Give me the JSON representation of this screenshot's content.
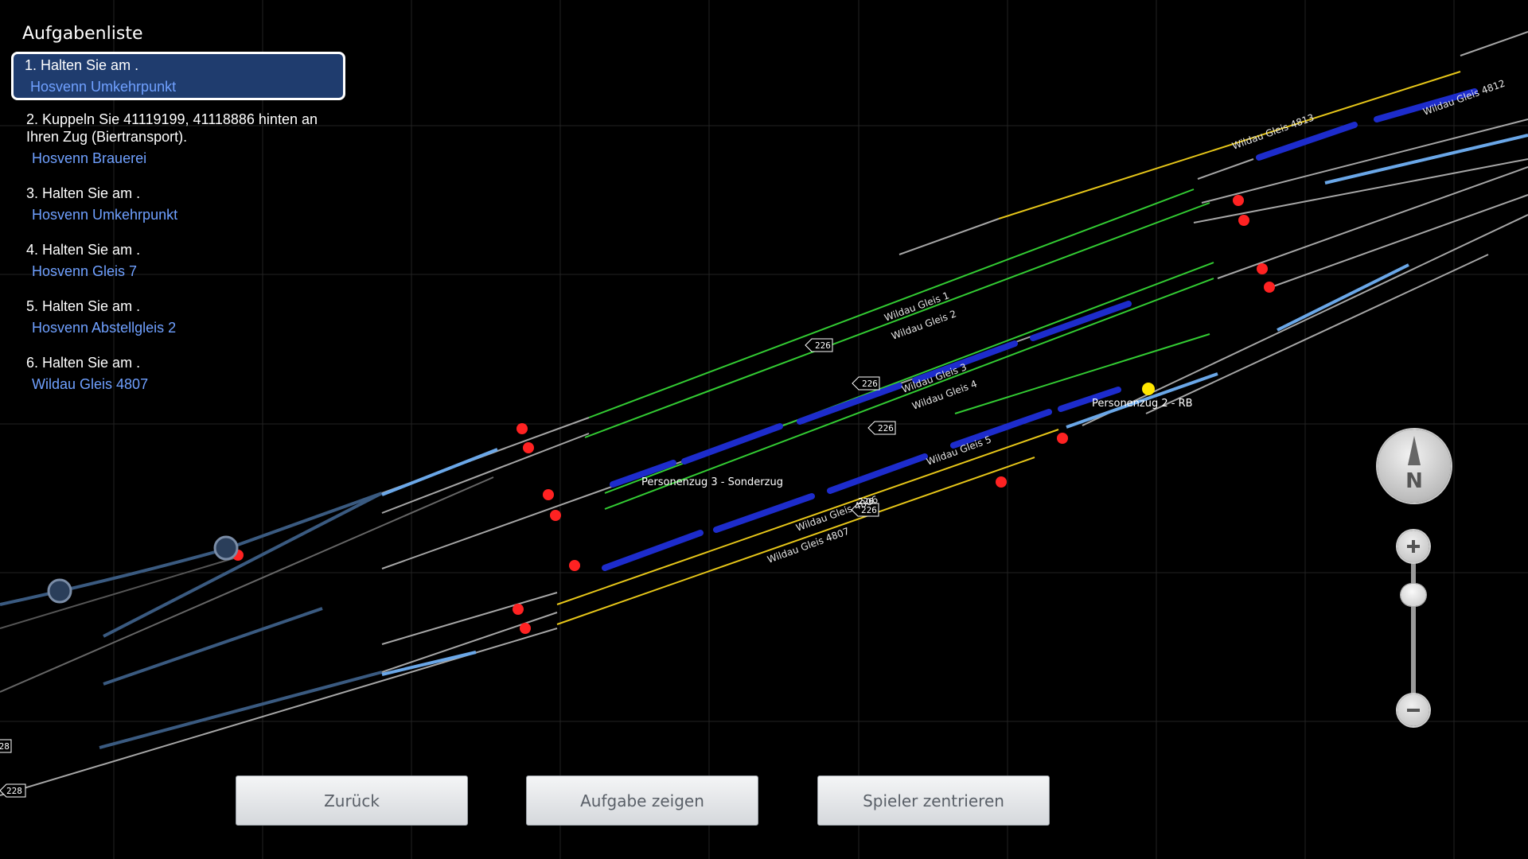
{
  "task_panel": {
    "title": "Aufgabenliste",
    "tasks": [
      {
        "text": "1. Halten Sie am .",
        "location": "Hosvenn Umkehrpunkt"
      },
      {
        "text": "2. Kuppeln Sie 41119199, 41118886 hinten an Ihren Zug (Biertransport).",
        "location": "Hosvenn Brauerei"
      },
      {
        "text": "3. Halten Sie am .",
        "location": "Hosvenn Umkehrpunkt"
      },
      {
        "text": "4. Halten Sie am .",
        "location": "Hosvenn Gleis 7"
      },
      {
        "text": "5. Halten Sie am .",
        "location": "Hosvenn Abstellgleis 2"
      },
      {
        "text": "6. Halten Sie am .",
        "location": "Wildau Gleis 4807"
      }
    ]
  },
  "map": {
    "track_labels": [
      "Wildau Gleis 1",
      "Wildau Gleis 2",
      "Wildau Gleis 3",
      "Wildau Gleis 4",
      "Wildau Gleis 5",
      "Wildau Gleis 4806",
      "Wildau Gleis 4807",
      "Wildau Gleis 4813",
      "Wildau Gleis 4812"
    ],
    "train_labels": [
      "Personenzug 3 - Sonderzug",
      "Personenzug 2 - RB"
    ],
    "speed_signs": [
      "226",
      "226",
      "226",
      "226",
      "226",
      "228",
      "228"
    ]
  },
  "buttons": {
    "back": "Zurück",
    "show_task": "Aufgabe zeigen",
    "center_player": "Spieler zentrieren"
  },
  "compass": {
    "letter": "N"
  },
  "icons": [
    "compass-icon",
    "zoom-in-icon",
    "zoom-out-icon",
    "signal-icon"
  ],
  "colors": {
    "background": "#000000",
    "active_task": "#1f3c6e",
    "location_text": "#6fa0ff",
    "track_green": "#33cc33",
    "track_yellow": "#e6c619",
    "track_grey": "#a6a6a6",
    "track_blue": "#6aa7e8",
    "train": "#1d2ccc",
    "signal_red": "#ff2222",
    "player_marker": "#ffe600"
  }
}
